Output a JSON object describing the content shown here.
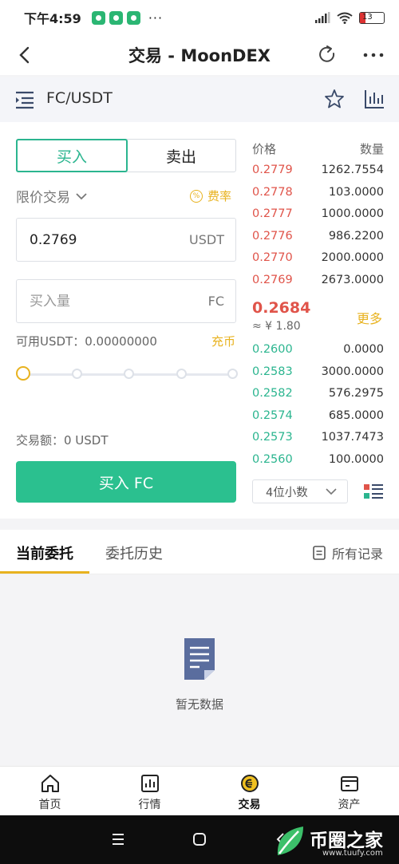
{
  "status": {
    "time": "下午4:59",
    "battery": "13",
    "more": "···"
  },
  "header": {
    "title": "交易 - MoonDEX"
  },
  "pair": {
    "name": "FC/USDT"
  },
  "trade": {
    "tabs": [
      "买入",
      "卖出"
    ],
    "order_type": "限价交易",
    "fee_label": "费率",
    "price_value": "0.2769",
    "price_unit": "USDT",
    "amount_placeholder": "买入量",
    "amount_unit": "FC",
    "available": "可用USDT：0.00000000",
    "charge": "充币",
    "slider_level_percent": 0,
    "total": "交易额：0 USDT",
    "buy_button": "买入 FC"
  },
  "orderbook": {
    "header_price": "价格",
    "header_qty": "数量",
    "asks": [
      {
        "price": "0.2779",
        "qty": "1262.7554"
      },
      {
        "price": "0.2778",
        "qty": "103.0000"
      },
      {
        "price": "0.2777",
        "qty": "1000.0000"
      },
      {
        "price": "0.2776",
        "qty": "986.2200"
      },
      {
        "price": "0.2770",
        "qty": "2000.0000"
      },
      {
        "price": "0.2769",
        "qty": "2673.0000"
      }
    ],
    "last_price": "0.2684",
    "approx": "≈ ¥ 1.80",
    "more": "更多",
    "bids": [
      {
        "price": "0.2600",
        "qty": "0.0000"
      },
      {
        "price": "0.2583",
        "qty": "3000.0000"
      },
      {
        "price": "0.2582",
        "qty": "576.2975"
      },
      {
        "price": "0.2574",
        "qty": "685.0000"
      },
      {
        "price": "0.2573",
        "qty": "1037.7473"
      },
      {
        "price": "0.2560",
        "qty": "100.0000"
      }
    ],
    "decimals": "4位小数"
  },
  "orders": {
    "tab_current": "当前委托",
    "tab_history": "委托历史",
    "all_records": "所有记录",
    "empty": "暂无数据"
  },
  "tabbar": [
    "首页",
    "行情",
    "交易",
    "资产"
  ],
  "watermark": {
    "text": "币圈之家",
    "url": "www.tuufy.com"
  },
  "colors": {
    "accent_green": "#2bc08f",
    "ask_red": "#e0544a",
    "gold": "#e8b21f"
  }
}
